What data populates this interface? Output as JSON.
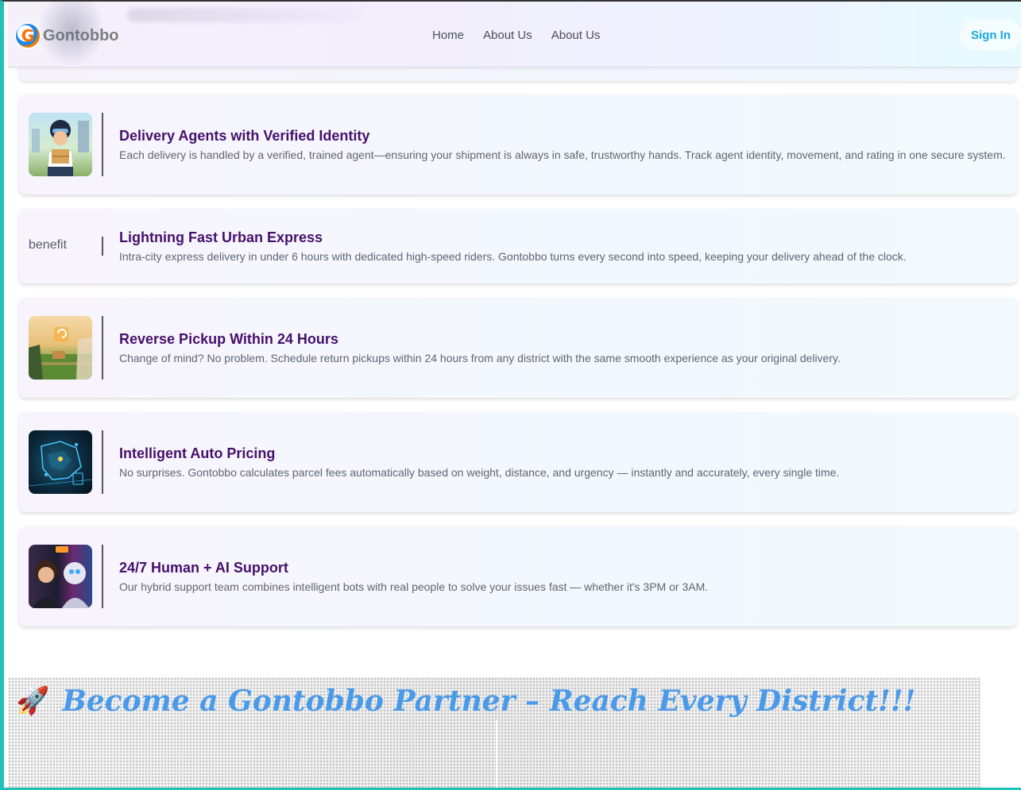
{
  "header": {
    "brand_name": "Gontobbo",
    "logo_letter": "G",
    "nav": [
      "Home",
      "About Us",
      "About Us"
    ],
    "signin_label": "Sign In"
  },
  "cards": [
    {
      "title": "Delivery Agents with Verified Identity",
      "desc": "Each delivery is handled by a verified, trained agent—ensuring your shipment is always in safe, trustworthy hands. Track agent identity, movement, and rating in one secure system.",
      "image": "delivery-agent-image"
    },
    {
      "title": "Lightning Fast Urban Express",
      "desc": "Intra-city express delivery in under 6 hours with dedicated high-speed riders. Gontobbo turns every second into speed, keeping your delivery ahead of the clock.",
      "image_alt": "benefit"
    },
    {
      "title": "Reverse Pickup Within 24 Hours",
      "desc": "Change of mind? No problem. Schedule return pickups within 24 hours from any district with the same smooth experience as your original delivery.",
      "image": "reverse-pickup-image"
    },
    {
      "title": "Intelligent Auto Pricing",
      "desc": "No surprises. Gontobbo calculates parcel fees automatically based on weight, distance, and urgency — instantly and accurately, every single time.",
      "image": "auto-pricing-image"
    },
    {
      "title": "24/7 Human + AI Support",
      "desc": "Our hybrid support team combines intelligent bots with real people to solve your issues fast — whether it's 3PM or 3AM.",
      "image": "support-image"
    }
  ],
  "banner": {
    "icon": "🚀",
    "title": "Become a Gontobbo Partner – Reach Every District!!!"
  },
  "colors": {
    "title": "#45106a",
    "accent": "#1aa7e0",
    "banner_text": "#4a9aea",
    "frame": "#22c0b8"
  }
}
